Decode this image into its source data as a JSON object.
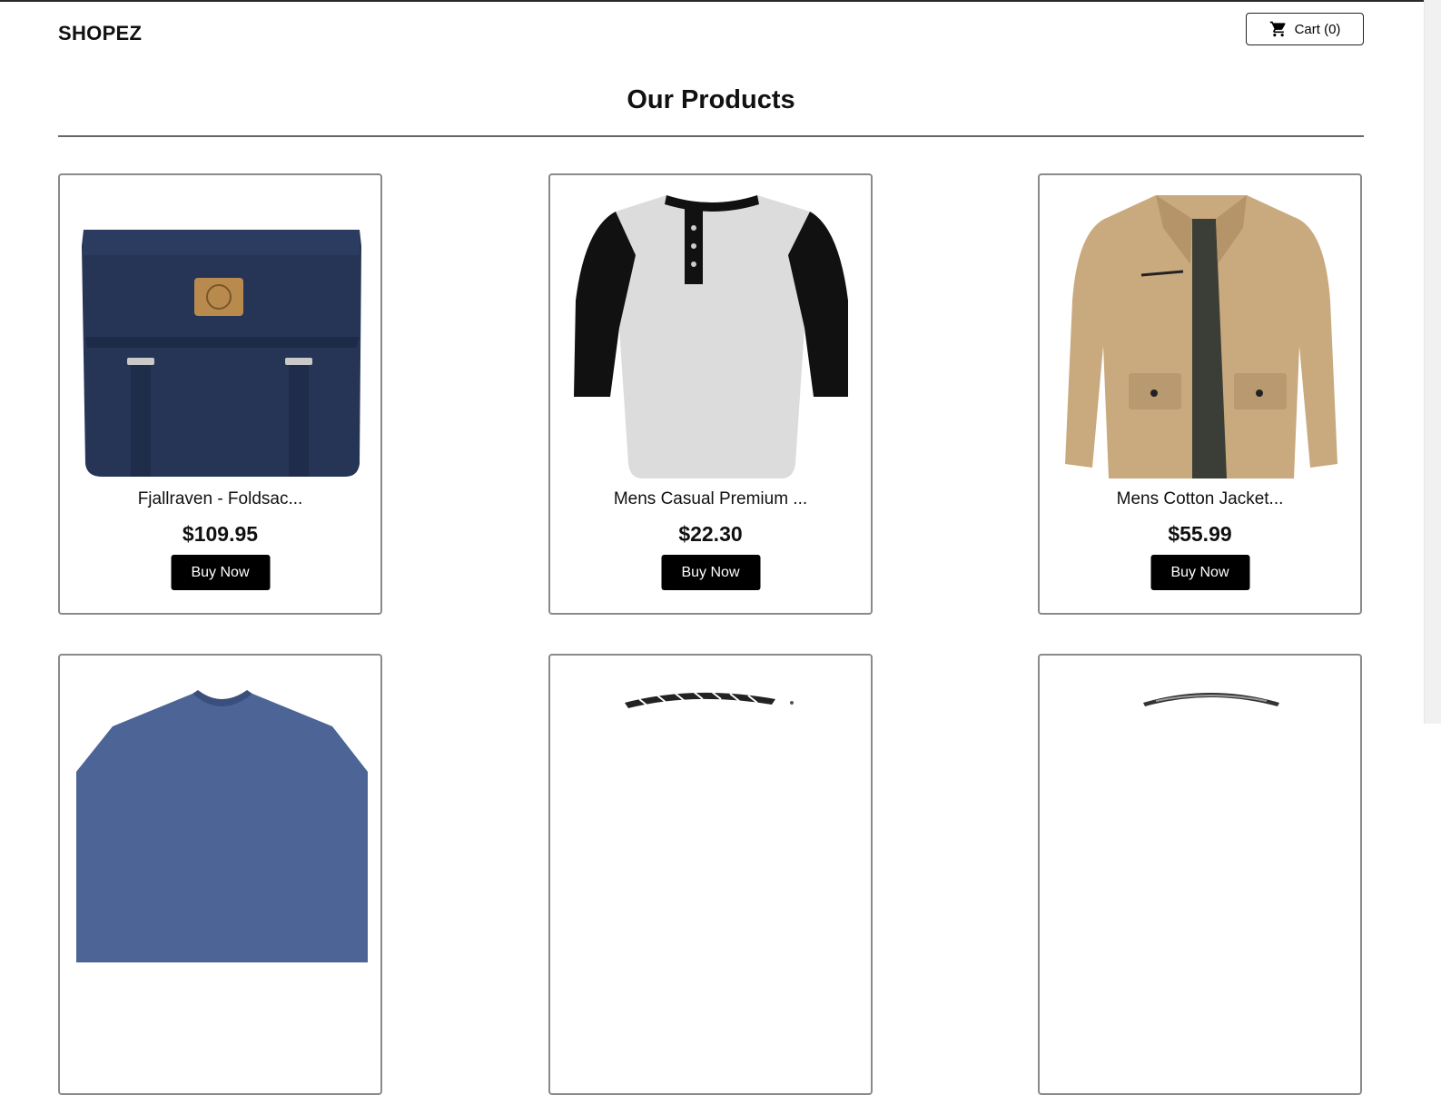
{
  "header": {
    "brand": "SHOPEZ",
    "cart_label": "Cart (0)"
  },
  "main": {
    "title": "Our Products",
    "products": [
      {
        "name": "Fjallraven - Foldsac...",
        "price": "$109.95",
        "buy_label": "Buy Now",
        "image": "navy-backpack"
      },
      {
        "name": "Mens Casual Premium ...",
        "price": "$22.30",
        "buy_label": "Buy Now",
        "image": "raglan-henley-shirt"
      },
      {
        "name": "Mens Cotton Jacket...",
        "price": "$55.99",
        "buy_label": "Buy Now",
        "image": "khaki-jacket"
      },
      {
        "image": "blue-vneck-tshirt"
      },
      {
        "image": "braided-bracelet"
      },
      {
        "image": "silver-ring"
      }
    ]
  },
  "colors": {
    "button_bg": "#000000",
    "border": "#8a8a8a"
  }
}
